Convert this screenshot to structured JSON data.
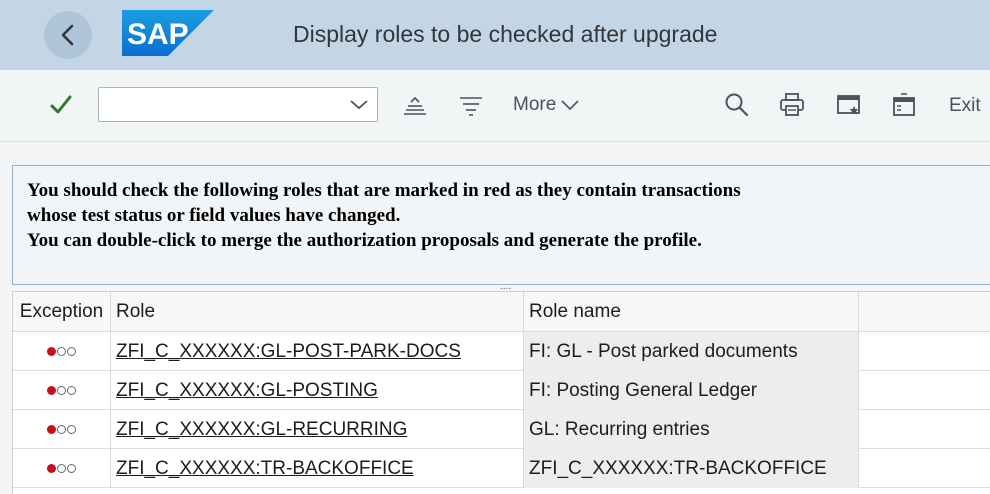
{
  "header": {
    "title": "Display roles to be checked after upgrade",
    "logo_text": "SAP",
    "brand_color": "#0a6ed1"
  },
  "toolbar": {
    "command_field": {
      "value": "",
      "placeholder": ""
    },
    "more_label": "More",
    "exit_label": "Exit"
  },
  "message": {
    "lines": [
      "You should check the following roles that are marked in red as they contain transactions",
      "whose test status or field values have changed.",
      "You can double-click to merge the authorization proposals and generate the profile."
    ],
    "splitter": "...."
  },
  "table": {
    "columns": [
      "Exception",
      "Role",
      "Role name"
    ],
    "rows": [
      {
        "exception": "red",
        "role": "ZFI_C_XXXXXX:GL-POST-PARK-DOCS",
        "role_name": "FI: GL - Post parked documents"
      },
      {
        "exception": "red",
        "role": "ZFI_C_XXXXXX:GL-POSTING",
        "role_name": "FI: Posting General Ledger"
      },
      {
        "exception": "red",
        "role": "ZFI_C_XXXXXX:GL-RECURRING",
        "role_name": "GL: Recurring entries"
      },
      {
        "exception": "red",
        "role": "ZFI_C_XXXXXX:TR-BACKOFFICE",
        "role_name": "ZFI_C_XXXXXX:TR-BACKOFFICE"
      }
    ]
  }
}
